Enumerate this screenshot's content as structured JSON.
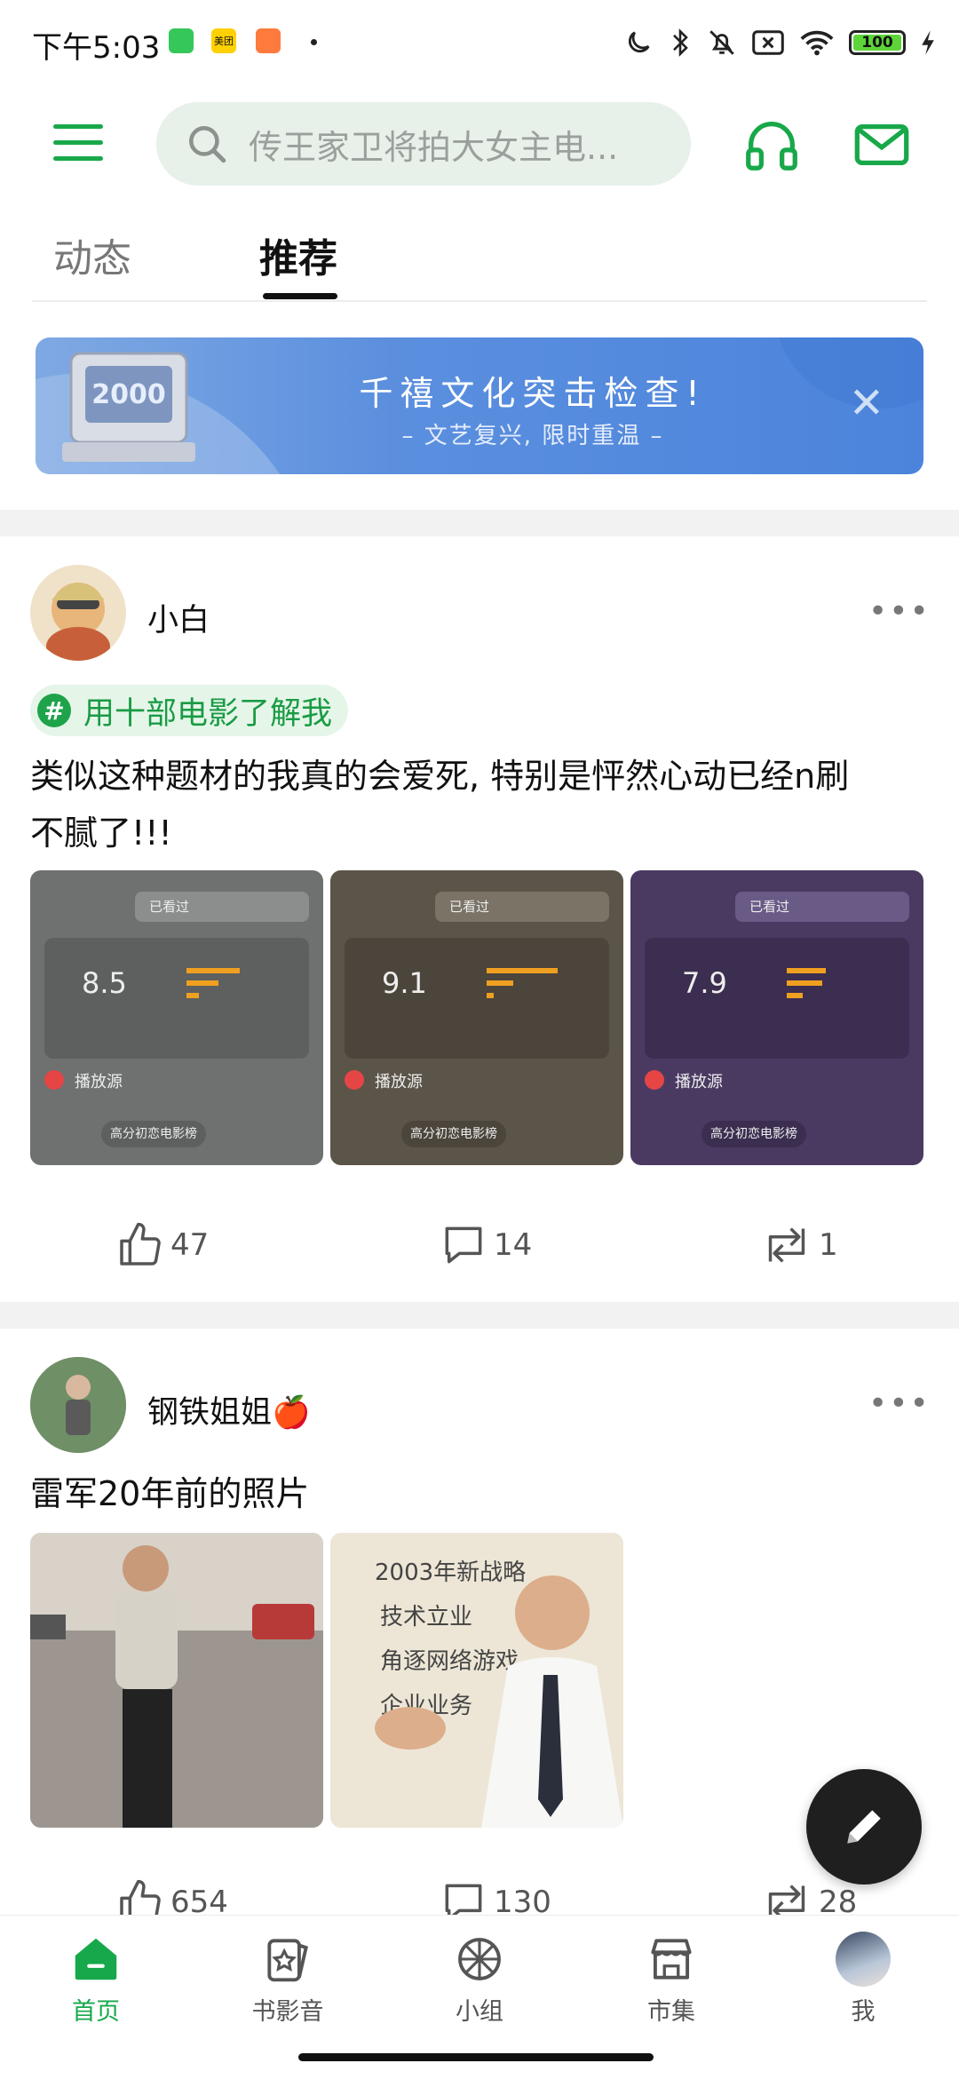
{
  "status_bar": {
    "time": "下午5:03",
    "battery": "100",
    "app_badge_2": "美团"
  },
  "header": {
    "search_placeholder": "传王家卫将拍大女主电..."
  },
  "tabs": [
    {
      "label": "动态",
      "active": false
    },
    {
      "label": "推荐",
      "active": true
    }
  ],
  "banner": {
    "title": "千禧文化突击检查!",
    "subtitle": "– 文艺复兴, 限时重温 –",
    "art_text": "2000"
  },
  "posts": [
    {
      "author": "小白",
      "topic": "用十部电影了解我",
      "text_line1": "类似这种题材的我真的会爱死, 特别是怦然心动已经n刷",
      "text_line2": "不腻了!!!",
      "cards": [
        {
          "rating": "8.5",
          "play": "播放源",
          "tag": "高分初恋电影榜",
          "watched": "已看过"
        },
        {
          "rating": "9.1",
          "play": "播放源",
          "tag": "高分初恋电影榜",
          "watched": "已看过"
        },
        {
          "rating": "7.9",
          "play": "播放源",
          "tag": "高分初恋电影榜",
          "watched": "已看过"
        }
      ],
      "likes": "47",
      "comments": "14",
      "reposts": "1"
    },
    {
      "author": "钢铁姐姐🍎",
      "text": "雷军20年前的照片",
      "photo2_lines": [
        "2003年新战略",
        "技术立业",
        "角逐网络游戏",
        "企业业务"
      ],
      "likes": "654",
      "comments": "130",
      "reposts": "28"
    }
  ],
  "bottom_nav": [
    {
      "label": "首页",
      "icon": "home-icon",
      "active": true
    },
    {
      "label": "书影音",
      "icon": "cards-icon",
      "active": false
    },
    {
      "label": "小组",
      "icon": "group-icon",
      "active": false
    },
    {
      "label": "市集",
      "icon": "store-icon",
      "active": false
    },
    {
      "label": "我",
      "icon": "avatar",
      "active": false
    }
  ],
  "colors": {
    "accent": "#17a84b",
    "banner": "#5b8fde",
    "topic_bg": "#e5f6e9"
  }
}
